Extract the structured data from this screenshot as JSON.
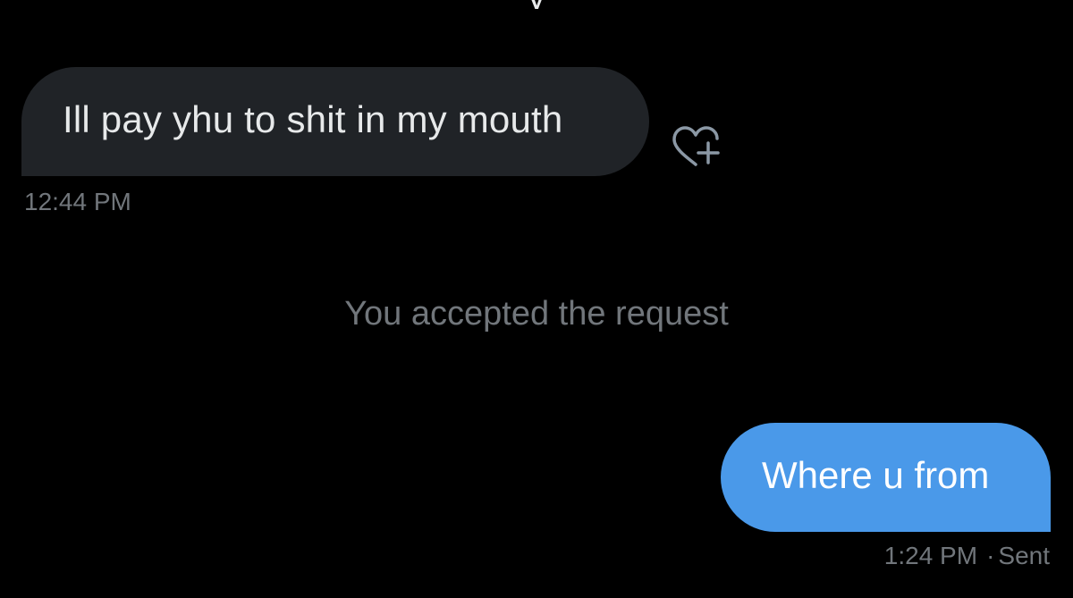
{
  "conversation": {
    "received_message": {
      "text": "Ill pay yhu to shit in my mouth",
      "timestamp": "12:44 PM",
      "reaction_icon": "heart-plus-icon"
    },
    "system_notice": "You accepted the request",
    "sent_message": {
      "text": "Where u from",
      "timestamp": "1:24 PM",
      "separator": "·",
      "status": "Sent"
    }
  },
  "colors": {
    "background": "#000000",
    "received_bubble": "#202327",
    "sent_bubble": "#4a99e9",
    "primary_text": "#e7e9ea",
    "secondary_text": "#71767b"
  }
}
